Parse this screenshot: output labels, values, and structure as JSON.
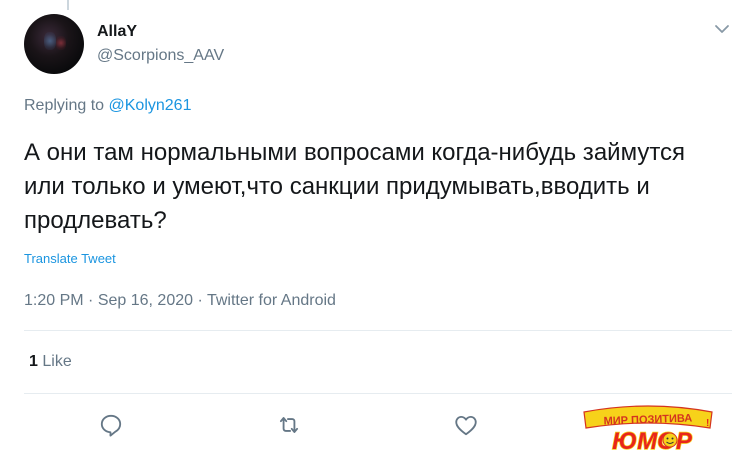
{
  "tweet": {
    "display_name": "AllaY",
    "screen_name": "@Scorpions_AAV",
    "replying_prefix": "Replying to",
    "replying_to": "@Kolyn261",
    "text": "А они там нормальными вопросами когда-нибудь займутся или только и умеют,что санкции придумывать,вводить и продлевать?",
    "translate_label": "Translate Tweet",
    "time": "1:20 PM",
    "date": "Sep 16, 2020",
    "source": "Twitter for Android",
    "separator": "·",
    "like_count": "1",
    "like_label": "Like"
  },
  "actions": {
    "reply_icon": "reply-icon",
    "retweet_icon": "retweet-icon",
    "like_icon": "heart-icon"
  },
  "watermark": {
    "line1": "МИР ПОЗИТИВА",
    "line2": "ЮМОР"
  },
  "colors": {
    "text": "#14171a",
    "secondary": "#657786",
    "link": "#1b95e0",
    "divider": "#e6ecf0"
  }
}
